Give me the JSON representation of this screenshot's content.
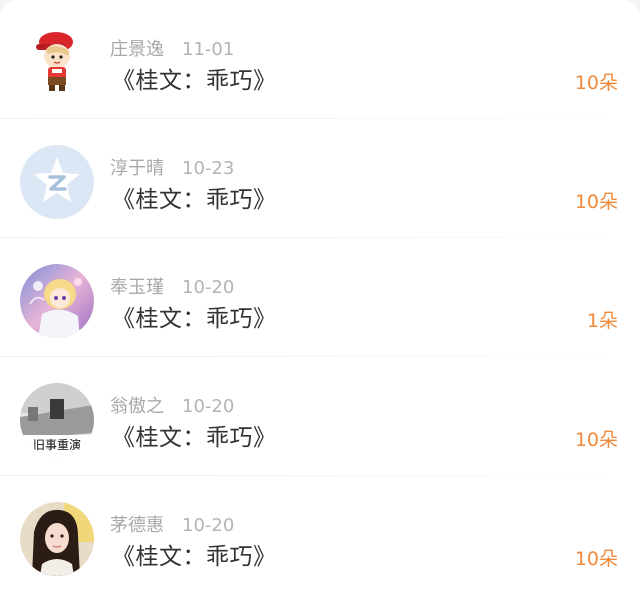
{
  "gifts": [
    {
      "name": "庄景逸",
      "date": "11-01",
      "title": "《桂文：乖巧》",
      "amount": "10朵",
      "avatar": "cartoon-boy-red-hat"
    },
    {
      "name": "淳于晴",
      "date": "10-23",
      "title": "《桂文：乖巧》",
      "amount": "10朵",
      "avatar": "default-z-star"
    },
    {
      "name": "奉玉瑾",
      "date": "10-20",
      "title": "《桂文：乖巧》",
      "amount": "1朵",
      "avatar": "anime-girl"
    },
    {
      "name": "翁傲之",
      "date": "10-20",
      "title": "《桂文：乖巧》",
      "amount": "10朵",
      "avatar": "grayscale-photo",
      "avatar_text": "旧事重演"
    },
    {
      "name": "茅德惠",
      "date": "10-20",
      "title": "《桂文：乖巧》",
      "amount": "10朵",
      "avatar": "portrait-photo"
    }
  ],
  "colors": {
    "amount": "#f08a3c",
    "name": "#a8a8a8",
    "title": "#333333",
    "background": "#ffffff"
  }
}
